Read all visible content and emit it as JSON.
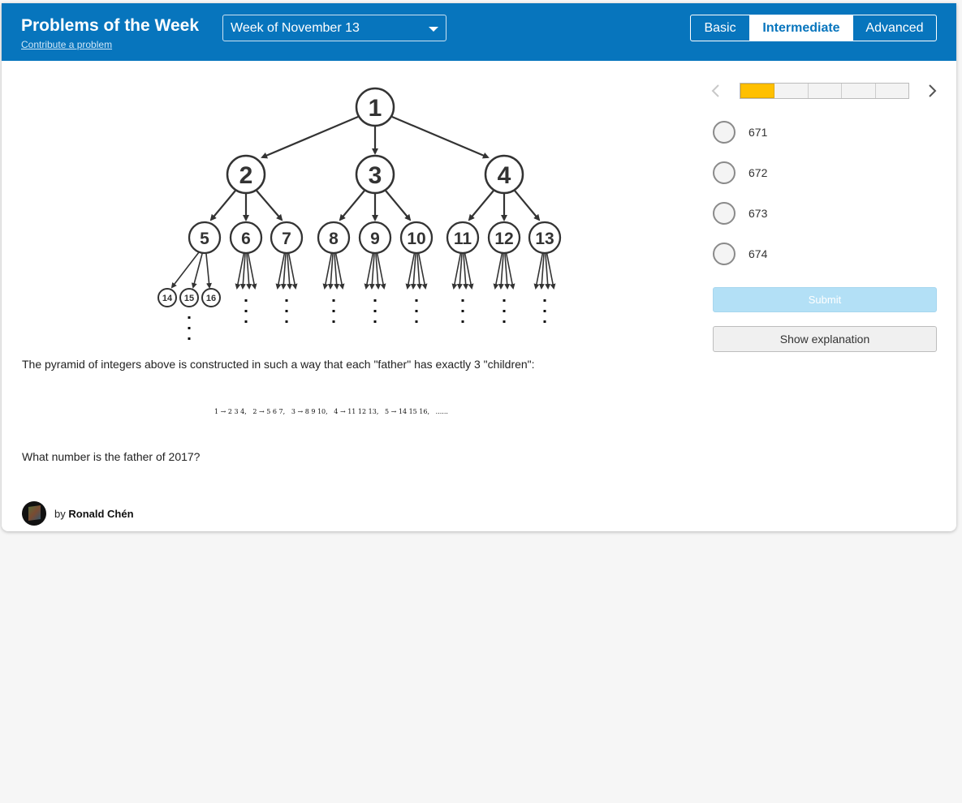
{
  "header": {
    "title": "Problems of the Week",
    "contribute_link": "Contribute a problem",
    "week_select": "Week of November 13",
    "levels": [
      "Basic",
      "Intermediate",
      "Advanced"
    ],
    "selected_level": "Intermediate",
    "brand_color": "#0775bd"
  },
  "diagram": {
    "root": "1",
    "level2": [
      "2",
      "3",
      "4"
    ],
    "level3": [
      "5",
      "6",
      "7",
      "8",
      "9",
      "10",
      "11",
      "12",
      "13"
    ],
    "level4": [
      "14",
      "15",
      "16"
    ]
  },
  "problem": {
    "intro": "The pyramid of integers above is constructed in such a way that each \"father\" has exactly 3 \"children\":",
    "sequence": "1 → 2 3 4,   2 → 5 6 7,   3 → 8 9 10,   4 → 11 12 13,   5 → 14 15 16,   ......",
    "question": "What number is the father of 2017?"
  },
  "author": {
    "prefix": "by",
    "name": "Ronald Chén"
  },
  "quiz": {
    "progress_current": 1,
    "progress_total": 5,
    "progress_color": "#ffc000",
    "options": [
      "671",
      "672",
      "673",
      "674"
    ],
    "submit_label": "Submit",
    "explanation_label": "Show explanation"
  }
}
